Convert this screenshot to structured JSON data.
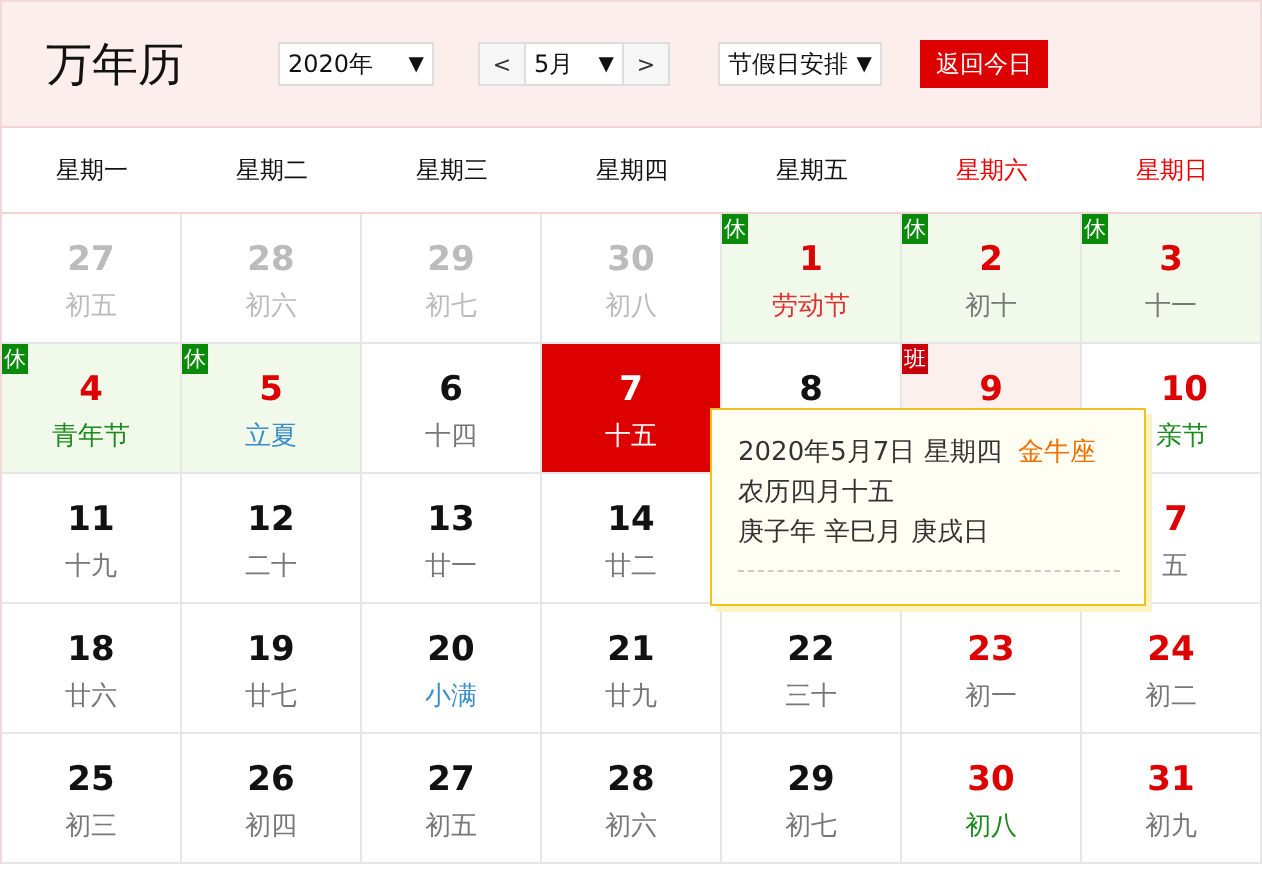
{
  "title": "万年历",
  "year_select": {
    "value": "2020年",
    "arrow": "▼"
  },
  "month_select": {
    "prev": "<",
    "value": "5月",
    "arrow": "▼",
    "next": ">"
  },
  "holiday_select": {
    "value": "节假日安排",
    "arrow": "▼"
  },
  "today_button": "返回今日",
  "weekdays": [
    {
      "label": "星期一",
      "weekend": false
    },
    {
      "label": "星期二",
      "weekend": false
    },
    {
      "label": "星期三",
      "weekend": false
    },
    {
      "label": "星期四",
      "weekend": false
    },
    {
      "label": "星期五",
      "weekend": false
    },
    {
      "label": "星期六",
      "weekend": true
    },
    {
      "label": "星期日",
      "weekend": true
    }
  ],
  "days": [
    {
      "number": {
        "text": "27",
        "kind": "faded"
      },
      "lunar": {
        "text": "初五",
        "kind": "faded"
      },
      "selected": false
    },
    {
      "number": {
        "text": "28",
        "kind": "faded"
      },
      "lunar": {
        "text": "初六",
        "kind": "faded"
      },
      "selected": false
    },
    {
      "number": {
        "text": "29",
        "kind": "faded"
      },
      "lunar": {
        "text": "初七",
        "kind": "faded"
      },
      "selected": false
    },
    {
      "number": {
        "text": "30",
        "kind": "faded"
      },
      "lunar": {
        "text": "初八",
        "kind": "faded"
      },
      "selected": false
    },
    {
      "number": {
        "text": "1",
        "kind": "red"
      },
      "lunar": {
        "text": "劳动节",
        "kind": "holiday"
      },
      "badge": {
        "text": "休",
        "kind": "rest"
      },
      "selected": false
    },
    {
      "number": {
        "text": "2",
        "kind": "red"
      },
      "lunar": {
        "text": "初十",
        "kind": "plain"
      },
      "badge": {
        "text": "休",
        "kind": "rest"
      },
      "selected": false
    },
    {
      "number": {
        "text": "3",
        "kind": "red"
      },
      "lunar": {
        "text": "十一",
        "kind": "plain"
      },
      "badge": {
        "text": "休",
        "kind": "rest"
      },
      "selected": false
    },
    {
      "number": {
        "text": "4",
        "kind": "red"
      },
      "lunar": {
        "text": "青年节",
        "kind": "festival"
      },
      "badge": {
        "text": "休",
        "kind": "rest"
      },
      "selected": false
    },
    {
      "number": {
        "text": "5",
        "kind": "red"
      },
      "lunar": {
        "text": "立夏",
        "kind": "term"
      },
      "badge": {
        "text": "休",
        "kind": "rest"
      },
      "selected": false
    },
    {
      "number": {
        "text": "6",
        "kind": "plain"
      },
      "lunar": {
        "text": "十四",
        "kind": "plain"
      },
      "selected": false
    },
    {
      "number": {
        "text": "7",
        "kind": "plain"
      },
      "lunar": {
        "text": "十五",
        "kind": "plain"
      },
      "selected": true
    },
    {
      "number": {
        "text": "8",
        "kind": "plain"
      },
      "selected": false
    },
    {
      "number": {
        "text": "9",
        "kind": "red"
      },
      "badge": {
        "text": "班",
        "kind": "work"
      },
      "selected": false
    },
    {
      "number": {
        "text": "10",
        "kind": "red"
      },
      "lunar": {
        "text": "亲节",
        "kind": "festival"
      },
      "selected": false
    },
    {
      "number": {
        "text": "11",
        "kind": "plain"
      },
      "lunar": {
        "text": "十九",
        "kind": "plain"
      },
      "selected": false
    },
    {
      "number": {
        "text": "12",
        "kind": "plain"
      },
      "lunar": {
        "text": "二十",
        "kind": "plain"
      },
      "selected": false
    },
    {
      "number": {
        "text": "13",
        "kind": "plain"
      },
      "lunar": {
        "text": "廿一",
        "kind": "plain"
      },
      "selected": false
    },
    {
      "number": {
        "text": "14",
        "kind": "plain"
      },
      "lunar": {
        "text": "廿二",
        "kind": "plain"
      },
      "selected": false
    },
    {
      "number": {
        "text": "7",
        "kind": "red"
      },
      "lunar": {
        "text": "五",
        "kind": "plain"
      },
      "selected": false
    },
    {
      "number": {
        "text": "18",
        "kind": "plain"
      },
      "lunar": {
        "text": "廿六",
        "kind": "plain"
      },
      "selected": false
    },
    {
      "number": {
        "text": "19",
        "kind": "plain"
      },
      "lunar": {
        "text": "廿七",
        "kind": "plain"
      },
      "selected": false
    },
    {
      "number": {
        "text": "20",
        "kind": "plain"
      },
      "lunar": {
        "text": "小满",
        "kind": "term"
      },
      "selected": false
    },
    {
      "number": {
        "text": "21",
        "kind": "plain"
      },
      "lunar": {
        "text": "廿九",
        "kind": "plain"
      },
      "selected": false
    },
    {
      "number": {
        "text": "22",
        "kind": "plain"
      },
      "lunar": {
        "text": "三十",
        "kind": "plain"
      },
      "selected": false
    },
    {
      "number": {
        "text": "23",
        "kind": "red"
      },
      "lunar": {
        "text": "初一",
        "kind": "plain"
      },
      "selected": false
    },
    {
      "number": {
        "text": "24",
        "kind": "red"
      },
      "lunar": {
        "text": "初二",
        "kind": "plain"
      },
      "selected": false
    },
    {
      "number": {
        "text": "25",
        "kind": "plain"
      },
      "lunar": {
        "text": "初三",
        "kind": "plain"
      },
      "selected": false
    },
    {
      "number": {
        "text": "26",
        "kind": "plain"
      },
      "lunar": {
        "text": "初四",
        "kind": "plain"
      },
      "selected": false
    },
    {
      "number": {
        "text": "27",
        "kind": "plain"
      },
      "lunar": {
        "text": "初五",
        "kind": "plain"
      },
      "selected": false
    },
    {
      "number": {
        "text": "28",
        "kind": "plain"
      },
      "lunar": {
        "text": "初六",
        "kind": "plain"
      },
      "selected": false
    },
    {
      "number": {
        "text": "29",
        "kind": "plain"
      },
      "lunar": {
        "text": "初七",
        "kind": "plain"
      },
      "selected": false
    },
    {
      "number": {
        "text": "30",
        "kind": "red"
      },
      "lunar": {
        "text": "初八",
        "kind": "festival"
      },
      "selected": false
    },
    {
      "number": {
        "text": "31",
        "kind": "red"
      },
      "lunar": {
        "text": "初九",
        "kind": "plain"
      },
      "selected": false
    }
  ],
  "tooltip": {
    "date": "2020年5月7日 星期四",
    "zodiac": "金牛座",
    "lunar_date": "农历四月十五",
    "ganzhi": "庚子年 辛巳月 庚戌日"
  }
}
